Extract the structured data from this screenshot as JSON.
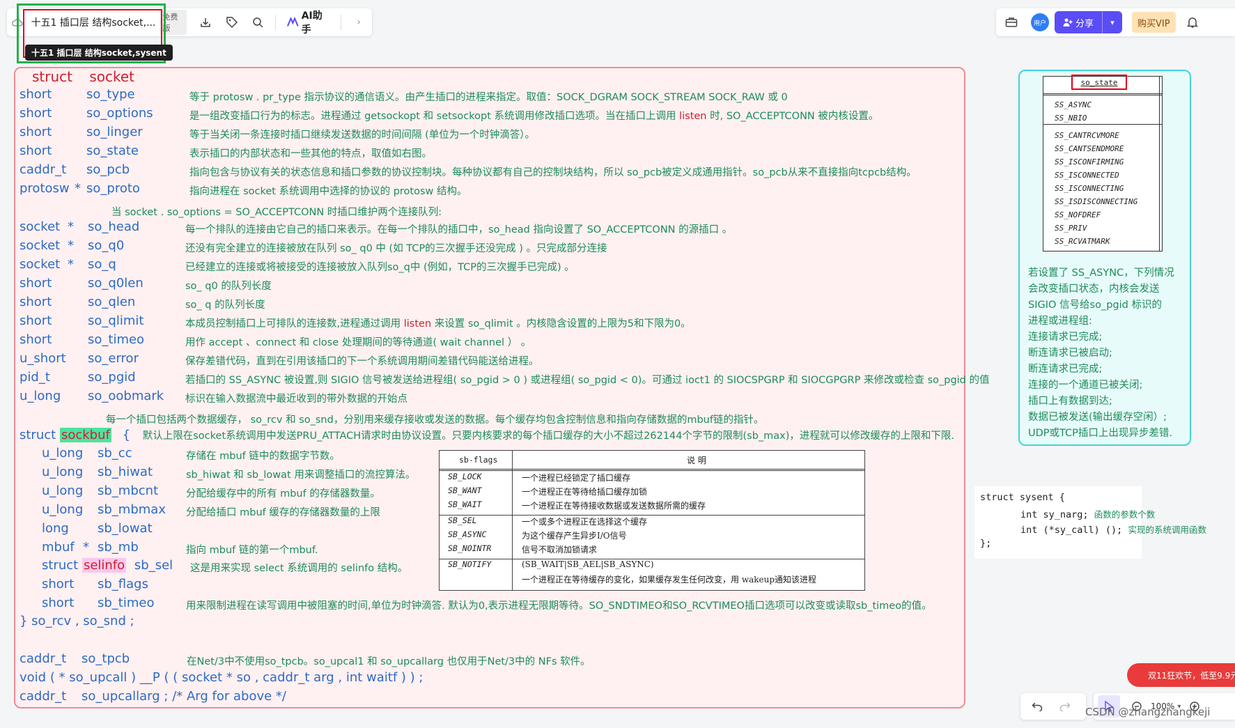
{
  "toolbar": {
    "doc_title": "十五1 插口层 结构socket,...",
    "free_tag": "免费版",
    "ai_label": "AI助手",
    "tooltip": "十五1 插口层 结构socket,sysent",
    "user_badge": "用户",
    "share_label": "分享",
    "vip_label": "购买VIP"
  },
  "socket": {
    "title_struct": "struct",
    "title_name": "socket",
    "fields": [
      {
        "type": "short",
        "ptr": "",
        "name": "so_type",
        "desc": "等于 protosw . pr_type 指示协议的通信语义。由产生插口的进程来指定。取值：SOCK_DGRAM     SOCK_STREAM     SOCK_RAW  或  0"
      },
      {
        "type": "short",
        "ptr": "",
        "name": "so_options",
        "desc": "是一组改变插口行为的标志。进程通过 getsockopt 和 setsockopt 系统调用修改插口选项。当在插口上调用 ",
        "desc_red": "listen",
        "desc_tail": " 时, SO_ACCEPTCONN 被内核设置。"
      },
      {
        "type": "short",
        "ptr": "",
        "name": "so_linger",
        "desc": "等于当关闭一条连接时插口继续发送数据的时间间隔 (单位为一个时钟滴答）。"
      },
      {
        "type": "short",
        "ptr": "",
        "name": "so_state",
        "desc": "表示插口的内部状态和一些其他的特点，取值如右图。"
      },
      {
        "type": "caddr_t",
        "ptr": "",
        "name": "so_pcb",
        "desc": "指向包含与协议有关的状态信息和插口参数的协议控制块。每种协议都有自己的控制块结构，所以 so_pcb被定义成通用指针。so_pcb从来不直接指向tcpcb结构。"
      },
      {
        "type": "protosw",
        "ptr": "*",
        "name": "so_proto",
        "desc": "指向进程在 socket 系统调用中选择的协议的 protosw 结构。"
      }
    ],
    "note_accept": "当 socket . so_options  = SO_ACCEPTCONN 时插口维护两个连接队列:",
    "queue_fields": [
      {
        "type": "socket",
        "ptr": "*",
        "name": "so_head",
        "desc": "每一个排队的连接由它自己的插口来表示。在每一个排队的插口中，so_head 指向设置了 SO_ACCEPTCONN 的源插口 。"
      },
      {
        "type": "socket",
        "ptr": "*",
        "name": "so_q0",
        "desc": "还没有完全建立的连接被放在队列  so_ q0 中 (如 TCP的三次握手还没完成 ) 。只完成部分连接"
      },
      {
        "type": "socket",
        "ptr": "*",
        "name": "so_q",
        "desc": "已经建立的连接或将被接受的连接被放入队列so_q中 (例如，TCP的三次握手已完成) 。"
      },
      {
        "type": "short",
        "ptr": "",
        "name": "so_q0len",
        "desc": "so_ q0 的队列长度"
      },
      {
        "type": "short",
        "ptr": "",
        "name": "so_qlen",
        "desc": "so_ q 的队列长度"
      },
      {
        "type": "short",
        "ptr": "",
        "name": "so_qlimit",
        "desc": "本成员控制插口上可排队的连接数,进程通过调用 ",
        "desc_red": "listen",
        "desc_tail": " 来设置 so_qlimit 。内核隐含设置的上限为5和下限为0。"
      },
      {
        "type": "short",
        "ptr": "",
        "name": "so_timeo",
        "desc": "用作 accept 、connect 和 close 处理期间的等待通道( wait  channel ）  。"
      },
      {
        "type": "u_short",
        "ptr": "",
        "name": "so_error",
        "desc": "保存差错代码，直到在引用该插口的下一个系统调用期间差错代码能送给进程。"
      },
      {
        "type": "pid_t",
        "ptr": "",
        "name": "so_pgid",
        "desc": "若插口的 SS_ASYNC 被设置,则 SIGIO 信号被发送给进程组( so_pgid > 0 ) 或进程组( so_pgid < 0)。可通过 ioct1 的 SIOCSPGRP 和 SIOCGPGRP 来修改或检查 so_pgid 的值"
      },
      {
        "type": "u_long",
        "ptr": "",
        "name": "so_oobmark",
        "desc": "标识在输入数据流中最近收到的带外数据的开始点"
      }
    ],
    "note_buffers": "每一个插口包括两个数据缓存，  so_rcv 和 so_snd，分别用来缓存接收或发送的数据。每个缓存均包含控制信息和指向存储数据的mbuf链的指针。",
    "sockbuf_struct": "struct",
    "sockbuf_name": "sockbuf",
    "sockbuf_brace": "{",
    "sockbuf_note": "默认上限在socket系统调用中发送PRU_ATTACH请求时由协议设置。只要内核要求的每个插口缓存的大小不超过262144个字节的限制(sb_max)，进程就可以修改缓存的上限和下限.",
    "sockbuf_fields": [
      {
        "type": "u_long",
        "ptr": "",
        "name": "sb_cc",
        "desc": "存储在 mbuf 链中的数据字节数。"
      },
      {
        "type": "u_long",
        "ptr": "",
        "name": "sb_hiwat",
        "desc": "sb_hiwat 和 sb_lowat 用来调整插口的流控算法。"
      },
      {
        "type": "u_long",
        "ptr": "",
        "name": "sb_mbcnt",
        "desc": "分配给缓存中的所有 mbuf 的存储器数量。"
      },
      {
        "type": "u_long",
        "ptr": "",
        "name": "sb_mbmax",
        "desc": "分配给插口 mbuf 缓存的存储器数量的上限"
      },
      {
        "type": "long",
        "ptr": "",
        "name": "sb_lowat",
        "desc": ""
      },
      {
        "type": "mbuf",
        "ptr": "*",
        "name": "sb_mb",
        "desc": "指向 mbuf 链的第一个mbuf."
      }
    ],
    "selinfo_struct": "struct",
    "selinfo_name": "selinfo",
    "selinfo_field": "sb_sel",
    "selinfo_desc": "这是用来实现 select 系统调用的 selinfo 结构。",
    "flags_type": "short",
    "flags_name": "sb_flags",
    "timeo_type": "short",
    "timeo_name": "sb_timeo",
    "timeo_desc": "用来限制进程在读写调用中被阻塞的时间,单位为时钟滴答. 默认为0,表示进程无限期等待。SO_SNDTIMEO和SO_RCVTIMEO插口选项可以改变或读取sb_timeo的值。",
    "sockbuf_close": "}  so_rcv  , so_snd ;",
    "tpcb_type": "caddr_t",
    "tpcb_name": "so_tpcb",
    "tpcb_desc": "在Net/3中不使用so_tpcb。so_upcal1 和 so_upcallarg 也仅用于Net/3中的 NFs 软件。",
    "upcall_line": "void ( * so_upcall ) __P ( ( socket * so , caddr_t  arg , int  waitf ) ) ;",
    "upcallarg_type": "caddr_t",
    "upcallarg_line": "so_upcallarg  ;  /* Arg for above */"
  },
  "sb_flags_table": {
    "col1_header": "sb-flags",
    "col2_header": "说      明",
    "groups": [
      [
        {
          "flag": "SB_LOCK",
          "desc": "一个进程已经锁定了插口缓存"
        },
        {
          "flag": "SB_WANT",
          "desc": "一个进程正在等待给插口缓存加锁"
        },
        {
          "flag": "SB_WAIT",
          "desc": "一个进程正在等待接收数据或发送数据所需的缓存"
        }
      ],
      [
        {
          "flag": "SB_SEL",
          "desc": "一个或多个进程正在选择这个缓存"
        },
        {
          "flag": "SB_ASYNC",
          "desc": "为这个缓存产生异步I/O信号"
        },
        {
          "flag": "SB_NOINTR",
          "desc": "信号不取消加锁请求"
        }
      ],
      [
        {
          "flag": "SB_NOTIFY",
          "desc": "(SB_WAIT|SB_AEL|SB_ASYNC)"
        },
        {
          "flag": "",
          "desc": "一个进程正在等待缓存的变化，如果缓存发生任何改变，用 wakeup通知该进程"
        }
      ]
    ]
  },
  "so_state_panel": {
    "header": "so_state",
    "group1": [
      "SS_ASYNC",
      "SS_NBIO"
    ],
    "group2": [
      "SS_CANTRCVMORE",
      "SS_CANTSENDMORE",
      "SS_ISCONFIRMING",
      "SS_ISCONNECTED",
      "SS_ISCONNECTING",
      "SS_ISDISCONNECTING",
      "SS_NOFDREF",
      "SS_PRIV",
      "SS_RCVATMARK"
    ],
    "notes": [
      "若设置了 SS_ASYNC，下列情况",
      "会改变插口状态，内核会发送",
      "SIGIO 信号给so_pgid 标识的",
      "进程或进程组:",
      "连接请求已完成;",
      "断连请求已被启动;",
      "断连请求已完成;",
      "连接的一个通道已被关闭;",
      "插口上有数据到达;",
      "数据已被发送(输出缓存空闲）;",
      "UDP或TCP插口上出现异步差错."
    ]
  },
  "sysent": {
    "line1": "struct sysent {",
    "line2_code": "int sy_narg;",
    "line2_note": "函数的参数个数",
    "line3_code": "int (*sy_call) ();",
    "line3_note": "实现的系统调用函数",
    "line4": "};"
  },
  "bottom": {
    "zoom": "100%",
    "promo": "双11狂欢节，低至9.9元",
    "watermark": "CSDN @zhangzhangkeji"
  },
  "colors": {
    "main_border": "#f08a95",
    "main_bg": "#fff0f1",
    "type_blue": "#2d6bc4",
    "desc_green": "#1d8c5a",
    "keyword_red": "#d0202c",
    "cyan_border": "#3fd6d6",
    "share_purple": "#5b4df5"
  }
}
